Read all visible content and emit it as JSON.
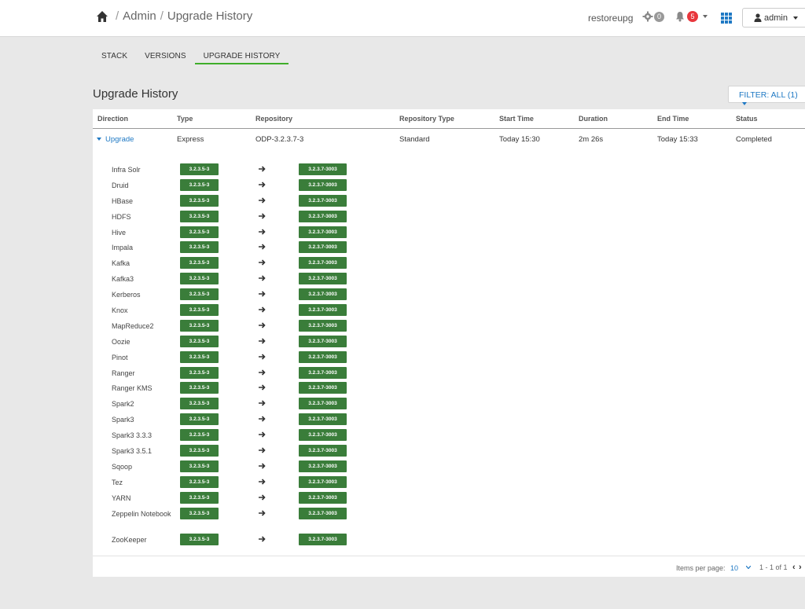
{
  "breadcrumb": {
    "home_icon": "home-icon",
    "admin": "Admin",
    "current": "Upgrade History"
  },
  "header": {
    "cluster": "restoreupg",
    "ops_count": "0",
    "alerts_count": "5",
    "user": "admin"
  },
  "tabs": [
    {
      "label": "STACK"
    },
    {
      "label": "VERSIONS"
    },
    {
      "label": "UPGRADE HISTORY",
      "active": true
    }
  ],
  "page": {
    "title": "Upgrade History",
    "filter_label": "FILTER: ALL (1)"
  },
  "table": {
    "columns": [
      "Direction",
      "Type",
      "Repository",
      "Repository Type",
      "Start Time",
      "Duration",
      "End Time",
      "Status"
    ],
    "row": {
      "direction": "Upgrade",
      "type": "Express",
      "repository": "ODP-3.2.3.7-3",
      "repository_type": "Standard",
      "start_time": "Today 15:30",
      "duration": "2m 26s",
      "end_time": "Today 15:33",
      "status": "Completed"
    }
  },
  "services": [
    {
      "name": "Infra Solr",
      "from": "3.2.3.5-3",
      "to": "3.2.3.7-3003"
    },
    {
      "name": "Druid",
      "from": "3.2.3.5-3",
      "to": "3.2.3.7-3003"
    },
    {
      "name": "HBase",
      "from": "3.2.3.5-3",
      "to": "3.2.3.7-3003"
    },
    {
      "name": "HDFS",
      "from": "3.2.3.5-3",
      "to": "3.2.3.7-3003"
    },
    {
      "name": "Hive",
      "from": "3.2.3.5-3",
      "to": "3.2.3.7-3003"
    },
    {
      "name": "Impala",
      "from": "3.2.3.5-3",
      "to": "3.2.3.7-3003"
    },
    {
      "name": "Kafka",
      "from": "3.2.3.5-3",
      "to": "3.2.3.7-3003"
    },
    {
      "name": "Kafka3",
      "from": "3.2.3.5-3",
      "to": "3.2.3.7-3003"
    },
    {
      "name": "Kerberos",
      "from": "3.2.3.5-3",
      "to": "3.2.3.7-3003"
    },
    {
      "name": "Knox",
      "from": "3.2.3.5-3",
      "to": "3.2.3.7-3003"
    },
    {
      "name": "MapReduce2",
      "from": "3.2.3.5-3",
      "to": "3.2.3.7-3003"
    },
    {
      "name": "Oozie",
      "from": "3.2.3.5-3",
      "to": "3.2.3.7-3003"
    },
    {
      "name": "Pinot",
      "from": "3.2.3.5-3",
      "to": "3.2.3.7-3003"
    },
    {
      "name": "Ranger",
      "from": "3.2.3.5-3",
      "to": "3.2.3.7-3003"
    },
    {
      "name": "Ranger KMS",
      "from": "3.2.3.5-3",
      "to": "3.2.3.7-3003"
    },
    {
      "name": "Spark2",
      "from": "3.2.3.5-3",
      "to": "3.2.3.7-3003"
    },
    {
      "name": "Spark3",
      "from": "3.2.3.5-3",
      "to": "3.2.3.7-3003"
    },
    {
      "name": "Spark3 3.3.3",
      "from": "3.2.3.5-3",
      "to": "3.2.3.7-3003"
    },
    {
      "name": "Spark3 3.5.1",
      "from": "3.2.3.5-3",
      "to": "3.2.3.7-3003"
    },
    {
      "name": "Sqoop",
      "from": "3.2.3.5-3",
      "to": "3.2.3.7-3003"
    },
    {
      "name": "Tez",
      "from": "3.2.3.5-3",
      "to": "3.2.3.7-3003"
    },
    {
      "name": "YARN",
      "from": "3.2.3.5-3",
      "to": "3.2.3.7-3003"
    },
    {
      "name": "Zeppelin Notebook",
      "from": "3.2.3.5-3",
      "to": "3.2.3.7-3003"
    },
    {
      "name": "ZooKeeper",
      "from": "3.2.3.5-3",
      "to": "3.2.3.7-3003"
    }
  ],
  "pagination": {
    "items_per_page_label": "Items per page:",
    "items_per_page": "10",
    "range": "1 - 1 of 1",
    "prev": "‹",
    "next": "›"
  },
  "colors": {
    "accent": "#1f79c4",
    "version_badge": "#3a7d3a",
    "active_tab": "#3fae2a",
    "alert": "#e8363c"
  }
}
